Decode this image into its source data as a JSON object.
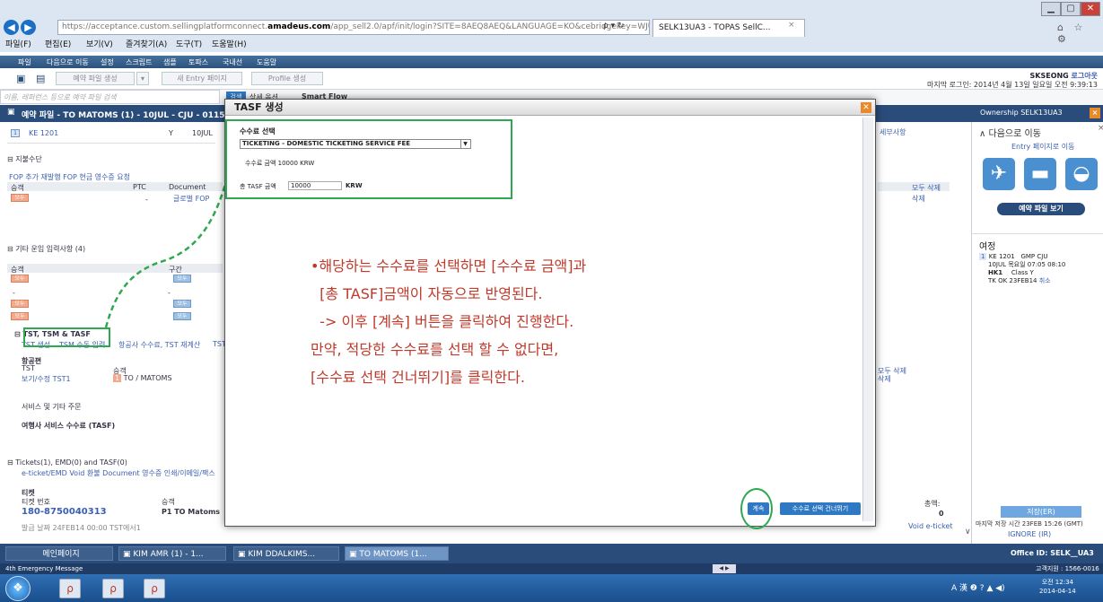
{
  "browser": {
    "url_prefix": "https://acceptance.custom.sellingplatformconnect.",
    "url_brand": "amadeus.com",
    "url_suffix": "/app_sell2.0/apf/init/login?SITE=8AEQ8AEQ&LANGUAGE=KO&cebridgekey=WJUNG_SOL",
    "addr_controls": "ρ ▾ ↻",
    "tab_title": "SELK13UA3 - TOPAS SellC...",
    "tab_close": "×",
    "menus": [
      "파일(F)",
      "편집(E)",
      "보기(V)",
      "즐겨찾기(A)",
      "도구(T)",
      "도움말(H)"
    ],
    "win_controls": [
      "▁",
      "▢",
      "✕"
    ],
    "ie_icons": "⌂ ☆ ⚙"
  },
  "app": {
    "menus": [
      "파일",
      "다음으로 이동",
      "설정",
      "스크립트",
      "샘플",
      "토파스",
      "국내선",
      "도움말"
    ],
    "toolbar": {
      "new_reservation": "예약 파일 생성",
      "new_entry": "새 Entry 페이지",
      "profile": "Profile 생성"
    },
    "login_user": "SKSEONG",
    "logout_link": "로그아웃",
    "last_login": "마지막 로그인: 2014년 4월 13일 일요일 오전 9:39:13",
    "search_placeholder": "이름, 레퍼런스 등으로 예약 파일 검색",
    "search_go": "검색",
    "search_links": [
      "상세 옵션",
      "Smart Flow"
    ],
    "title_bar": "예약 파일 - TO MATOMS (1) - 10JUL - CJU - 0115",
    "ownership": "Ownership SELK13UA3"
  },
  "left": {
    "flight": {
      "code": "KE 1201",
      "class": "Y",
      "date": "10JUL"
    },
    "fop_title": "지불수단",
    "fop_links": "FOP 추가   재발행 FOP   현금 영수증 요청",
    "fop_headers": [
      "승객",
      "PTC",
      "Document"
    ],
    "fop_row": {
      "passenger": "모두",
      "ptc": "-",
      "doc": "글로벌 FOP"
    },
    "fop_delete_all": "모두 삭제",
    "fop_delete": "삭제",
    "other_title": "기타 운임 입력사항 (4)",
    "other_headers": [
      "승객",
      "구간"
    ],
    "tag_all": "모두",
    "tst_title": "TST, TSM & TASF",
    "tst_links": [
      "TST 생성",
      "TSM 수동 입력",
      "항공사 수수료, TST 재계산",
      "TST"
    ],
    "airline_title": "항공편",
    "tst_label": "TST",
    "tst_headers": [
      "승객"
    ],
    "tst_view_link": "보기/수정 TST1",
    "tst_passenger": "TO / MATOMS",
    "service_title": "서비스 및 기타 주문",
    "tasf_title": "여행사 서비스 수수료 (TASF)",
    "tickets_title": "Tickets(1), EMD(0) and TASF(0)",
    "tickets_links": "e-ticket/EMD Void   환불   Document 영수증 인쇄/이메일/팩스",
    "ticket_label": "티켓",
    "ticket_headers": [
      "티켓 번호",
      "승객"
    ],
    "ticket_no": "180-8750040313",
    "ticket_passenger": "P1 TO Matoms",
    "ticket_issued": "발급 날짜 24FEB14 00:00 TST에서1",
    "ticket_amount_label": "총액:",
    "ticket_amount": "0",
    "void_eticket": "Void e-ticket",
    "service_link": "세부사항",
    "delete_all2": "모두 삭제",
    "delete2": "삭제"
  },
  "right": {
    "goto_title": "다음으로 이동",
    "entry_link": "Entry 페이지로 이동",
    "view_file_btn": "예약 파일 보기",
    "itinerary_title": "여정",
    "itin": {
      "flight": "KE 1201",
      "route": "GMP  CJU",
      "date": "10JUL 목요일",
      "time": "07:05  08:10",
      "status": "HK1",
      "class": "Class Y",
      "tk": "TK OK 23FEB14",
      "cancel": "취소"
    },
    "save_btn": "저장(ER)",
    "last_saved": "마지막 저장 시간 23FEB 15:26 (GMT)",
    "ignore": "IGNORE (IR)"
  },
  "modal": {
    "title": "TASF 생성",
    "fee_select_label": "수수료 선택",
    "fee_selected": "TICKETING - DOMESTIC TICKETING SERVICE FEE",
    "fee_amount": "수수료 금액 10000 KRW",
    "total_label": "총 TASF 금액",
    "total_value": "10000",
    "total_currency": "KRW",
    "continue_btn": "계속",
    "skip_btn": "수수료 선택 건너뛰기",
    "instruction": "•해당하는 수수료를 선택하면 [수수료 금액]과\n  [총 TASF]금액이 자동으로 반영된다.\n  -> 이후 [계속] 버튼을 클릭하여 진행한다.\n만약, 적당한 수수료를 선택 할 수 없다면,\n[수수료 선택 건너뛰기]를 클릭한다."
  },
  "taskbar": {
    "tabs": [
      "메인페이지",
      "KIM AMR (1) - 1...",
      "KIM DDALKIMS...",
      "TO MATOMS (1..."
    ],
    "office": "Office ID: SELK__UA3",
    "support": "고객지원 : 1566-0016",
    "emergency": "4th Emergency Message",
    "clock_time": "오전 12:34",
    "clock_date": "2014-04-14",
    "tray": "A 漢 ❷ ? ▲ ◀)"
  },
  "colors": {
    "accent": "#2a4c7a",
    "highlight": "#2fa84f",
    "instruction": "#c0392b",
    "button": "#2f78c4"
  }
}
